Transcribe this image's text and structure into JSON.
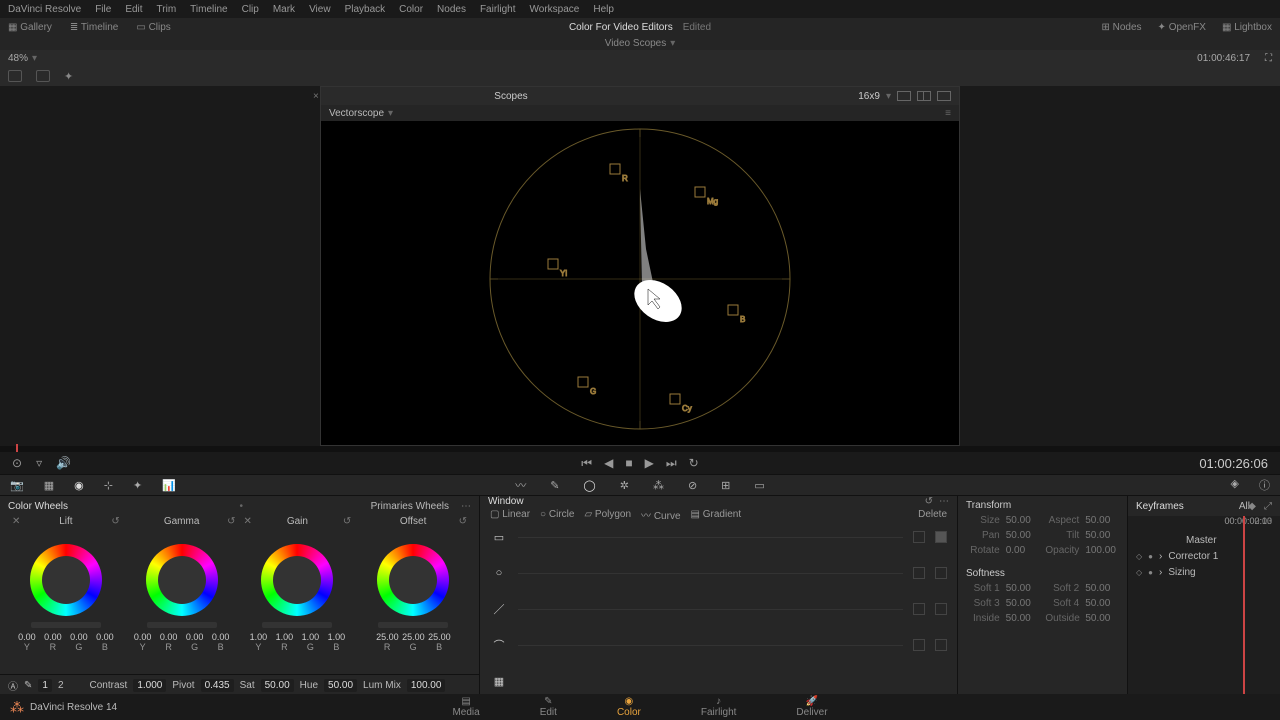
{
  "menu": {
    "items": [
      "DaVinci Resolve",
      "File",
      "Edit",
      "Trim",
      "Timeline",
      "Clip",
      "Mark",
      "View",
      "Playback",
      "Color",
      "Nodes",
      "Fairlight",
      "Workspace",
      "Help"
    ]
  },
  "toolbar1": {
    "gallery": "Gallery",
    "timeline": "Timeline",
    "clips": "Clips",
    "project": "Color For Video Editors",
    "edited": "Edited",
    "nodes": "Nodes",
    "openfx": "OpenFX",
    "lightbox": "Lightbox"
  },
  "subtitle": "Video Scopes",
  "zoom": "48%",
  "timecode_top": "01:00:46:17",
  "scope": {
    "title": "Scopes",
    "aspect": "16x9",
    "type": "Vectorscope",
    "targets": [
      "R",
      "Mg",
      "B",
      "Cy",
      "G",
      "Yl"
    ]
  },
  "transport": {
    "tc": "01:00:26:06"
  },
  "colorwheels": {
    "title": "Color Wheels",
    "mode": "Primaries Wheels",
    "wheels": [
      {
        "name": "Lift",
        "vals": [
          "0.00",
          "0.00",
          "0.00",
          "0.00"
        ]
      },
      {
        "name": "Gamma",
        "vals": [
          "0.00",
          "0.00",
          "0.00",
          "0.00"
        ]
      },
      {
        "name": "Gain",
        "vals": [
          "1.00",
          "1.00",
          "1.00",
          "1.00"
        ]
      },
      {
        "name": "Offset",
        "vals": [
          "25.00",
          "25.00",
          "25.00"
        ]
      }
    ],
    "channels": [
      "Y",
      "R",
      "G",
      "B"
    ],
    "contrast": {
      "page1": "1",
      "page2": "2",
      "contrast_l": "Contrast",
      "contrast": "1.000",
      "pivot_l": "Pivot",
      "pivot": "0.435",
      "sat_l": "Sat",
      "sat": "50.00",
      "hue_l": "Hue",
      "hue": "50.00",
      "lummix_l": "Lum Mix",
      "lummix": "100.00"
    }
  },
  "window": {
    "title": "Window",
    "tools": {
      "linear": "Linear",
      "circle": "Circle",
      "polygon": "Polygon",
      "curve": "Curve",
      "gradient": "Gradient",
      "delete": "Delete"
    }
  },
  "transform": {
    "title": "Transform",
    "rows": [
      [
        "Size",
        "50.00",
        "Aspect",
        "50.00"
      ],
      [
        "Pan",
        "50.00",
        "Tilt",
        "50.00"
      ],
      [
        "Rotate",
        "0.00",
        "Opacity",
        "100.00"
      ]
    ],
    "soft_title": "Softness",
    "soft": [
      [
        "Soft 1",
        "50.00",
        "Soft 2",
        "50.00"
      ],
      [
        "Soft 3",
        "50.00",
        "Soft 4",
        "50.00"
      ],
      [
        "Inside",
        "50.00",
        "Outside",
        "50.00"
      ]
    ]
  },
  "keyframes": {
    "title": "Keyframes",
    "filter": "All",
    "tc_left": "00:00:00:00",
    "tc_right": "00:00:02:13",
    "master": "Master",
    "rows": [
      "Corrector 1",
      "Sizing"
    ]
  },
  "pages": {
    "media": "Media",
    "edit": "Edit",
    "color": "Color",
    "fairlight": "Fairlight",
    "deliver": "Deliver",
    "app": "DaVinci Resolve 14"
  }
}
